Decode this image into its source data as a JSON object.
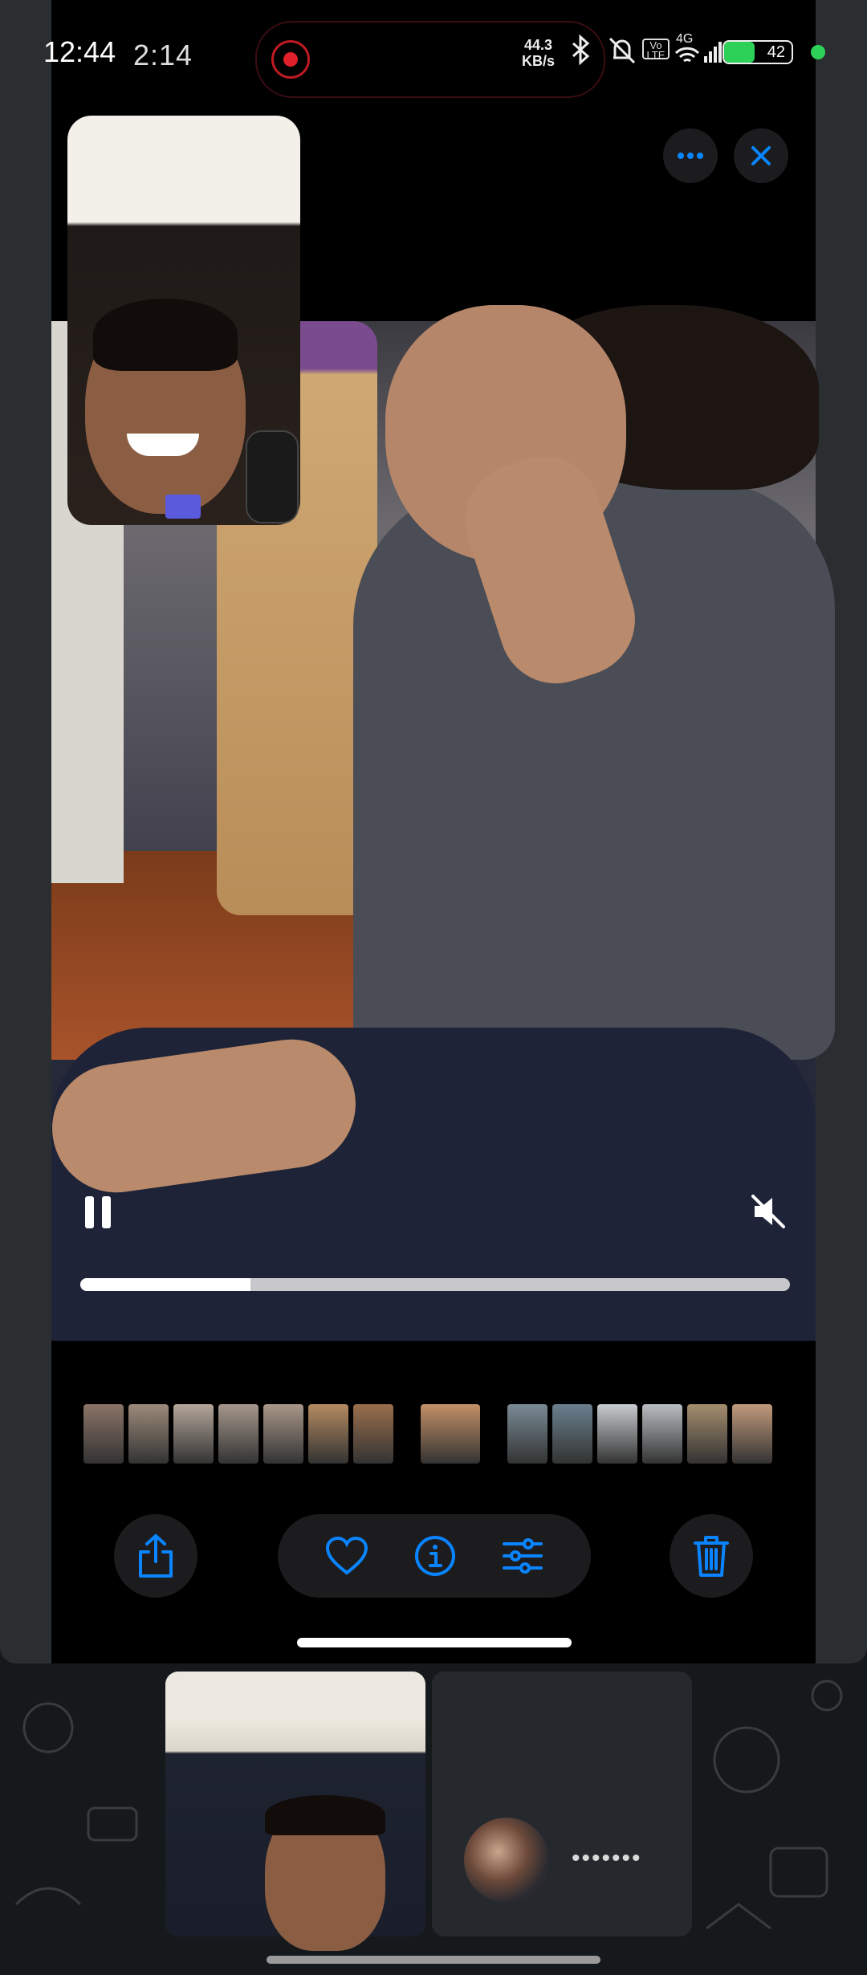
{
  "status_bar": {
    "time": "12:44",
    "call_duration": "2:14",
    "net_speed_value": "44.3",
    "net_speed_unit": "KB/s",
    "volte": "Vo LTE",
    "network": "4G",
    "battery": "42"
  },
  "screen_share": {
    "more_button": "more-options",
    "close_button": "close",
    "video_progress": 0.24,
    "filmstrip_colors": [
      "#8a7466",
      "#9d8a7a",
      "#b4a69a",
      "#a5978c",
      "#a89688",
      "#b58a60",
      "#9a6e4d",
      "#c39067",
      "#7a8a95",
      "#6a7f8e",
      "#c8cbcf",
      "#b9bdc2",
      "#a48d6e",
      "#c29a7d"
    ],
    "toolbar": {
      "share": "share-icon",
      "favorite": "heart-icon",
      "info": "info-icon",
      "adjust": "adjust-icon",
      "delete": "trash-icon"
    },
    "accent": "#0a84ff"
  },
  "call": {
    "status_dots": "•••••••"
  }
}
